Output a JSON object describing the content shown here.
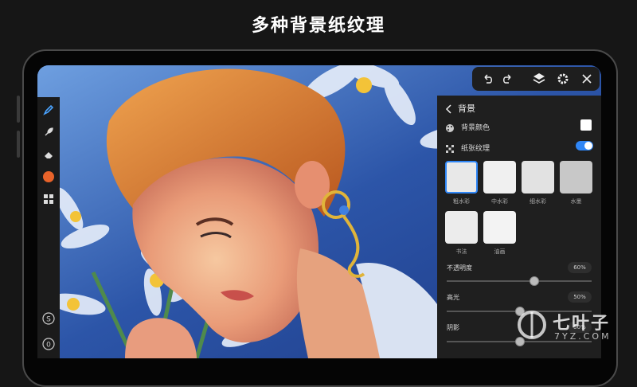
{
  "headline": "多种背景纸纹理",
  "panel": {
    "title": "背景",
    "background_color_label": "背景颜色",
    "paper_texture_label": "纸张纹理",
    "paper_texture_enabled": true,
    "textures": [
      {
        "label": "粗水彩",
        "selected": true
      },
      {
        "label": "中水彩",
        "selected": false
      },
      {
        "label": "细水彩",
        "selected": false
      },
      {
        "label": "水墨",
        "selected": false
      },
      {
        "label": "书法",
        "selected": false
      },
      {
        "label": "油画",
        "selected": false
      }
    ],
    "opacity": {
      "label": "不透明度",
      "value": "60%"
    },
    "highlight": {
      "label": "高光",
      "value": "50%"
    },
    "shadow": {
      "label": "阴影",
      "value": "50%"
    }
  },
  "watermark": {
    "brand": "七叶子",
    "domain": "7YZ.COM"
  },
  "colors": {
    "accent": "#2f86f6",
    "brush_color": "#e8632a",
    "panel_bg": "#1f1f1f"
  },
  "icons": [
    "undo-icon",
    "redo-icon",
    "layers-icon",
    "settings-icon",
    "close-icon",
    "pen-icon",
    "smudge-icon",
    "eraser-icon",
    "color-swatch",
    "grid-icon",
    "s-icon",
    "o-icon"
  ]
}
